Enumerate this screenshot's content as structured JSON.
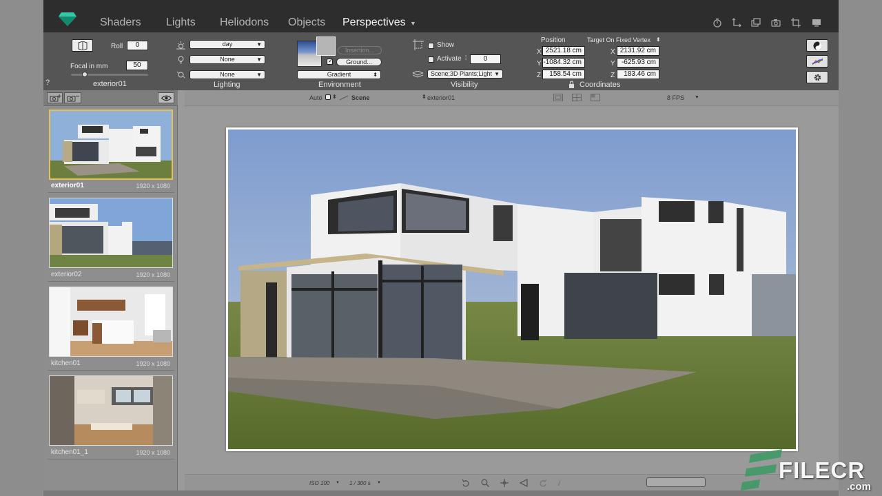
{
  "nav": {
    "tabs": [
      "Shaders",
      "Lights",
      "Heliodons",
      "Objects",
      "Perspectives"
    ],
    "active_index": 4
  },
  "camera": {
    "roll_label": "Roll",
    "roll_value": "0",
    "focal_label": "Focal in mm",
    "focal_value": "50",
    "focal_slider_fraction": 0.18,
    "name": "exterior01",
    "help": "?"
  },
  "lighting": {
    "title": "Lighting",
    "sun": "day",
    "artificial": "None",
    "neon": "None"
  },
  "environment": {
    "title": "Environment",
    "insertion_label": "Insertion...",
    "ground_label": "Ground...",
    "type": "Gradient"
  },
  "visibility": {
    "title": "Visibility",
    "show_label": "Show",
    "activate_label": "Activate",
    "activate_value": "0",
    "layers": "Scene;3D Plants;Light"
  },
  "coordinates": {
    "title": "Coordinates",
    "position_label": "Position",
    "target_label": "Target On Fixed Vertex",
    "position": {
      "x": "2521.18 cm",
      "y": "-1084.32 cm",
      "z": "158.54 cm"
    },
    "target": {
      "x": "2131.92 cm",
      "y": "-625.93 cm",
      "z": "183.46 cm"
    },
    "axis_x": "X",
    "axis_y": "Y",
    "axis_z": "Z"
  },
  "viewbar": {
    "auto_label": "Auto",
    "scene_label": "Scene",
    "camera_name": "exterior01",
    "fps": "8 FPS"
  },
  "perspectives": [
    {
      "name": "exterior01",
      "dims": "1920 x 1080",
      "selected": true
    },
    {
      "name": "exterior02",
      "dims": "1920 x 1080",
      "selected": false
    },
    {
      "name": "kitchen01",
      "dims": "1920 x 1080",
      "selected": false
    },
    {
      "name": "kitchen01_1",
      "dims": "1920 x 1080",
      "selected": false
    }
  ],
  "bottombar": {
    "iso": "ISO 100",
    "shutter": "1 / 300 s"
  },
  "watermark": {
    "text": "FILECR",
    "suffix": ".com"
  },
  "colors": {
    "accent_selected": "#e6c25a",
    "nav_bg": "#2d2d2d",
    "toolbar_bg": "#555555",
    "logo": "#1fa58a",
    "watermark_green": "#2e8b57"
  }
}
